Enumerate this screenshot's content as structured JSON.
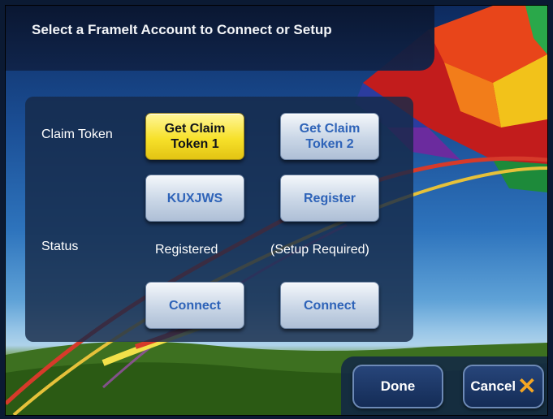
{
  "title": "Select a FrameIt Account to Connect or Setup",
  "labels": {
    "claim_token": "Claim Token",
    "status": "Status"
  },
  "accounts": [
    {
      "claim_button": "Get Claim Token 1",
      "claim_selected": true,
      "token_button": "KUXJWS",
      "status": "Registered",
      "connect_button": "Connect"
    },
    {
      "claim_button": "Get Claim Token 2",
      "claim_selected": false,
      "token_button": "Register",
      "status": "(Setup Required)",
      "connect_button": "Connect"
    }
  ],
  "footer": {
    "done_label": "Done",
    "cancel_label": "Cancel",
    "cancel_icon": "x-icon"
  },
  "colors": {
    "selected_button": "#f7e12a",
    "button_text": "#2e63b8",
    "cancel_x": "#f5a623"
  }
}
